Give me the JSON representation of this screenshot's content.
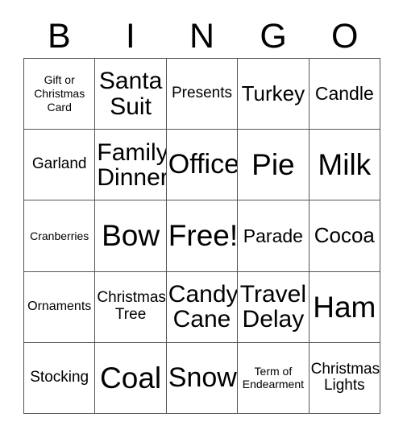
{
  "card": {
    "title_letters": [
      "B",
      "I",
      "N",
      "G",
      "O"
    ],
    "grid_columns": 5,
    "grid_rows": 5,
    "text_color": "#000000",
    "border_color": "#555555",
    "background_color": "#ffffff",
    "cells": [
      [
        {
          "label": "Gift or\nChristmas\nCard",
          "size": "fs-xs",
          "free": false
        },
        {
          "label": "Santa\nSuit",
          "size": "fs-xxl",
          "free": false
        },
        {
          "label": "Presents",
          "size": "fs-m",
          "free": false
        },
        {
          "label": "Turkey",
          "size": "fs-xl",
          "free": false
        },
        {
          "label": "Candle",
          "size": "fs-l",
          "free": false
        }
      ],
      [
        {
          "label": "Garland",
          "size": "fs-m",
          "free": false
        },
        {
          "label": "Family\nDinner",
          "size": "fs-xxl",
          "free": false
        },
        {
          "label": "Office",
          "size": "fs-3xl",
          "free": false
        },
        {
          "label": "Pie",
          "size": "fs-4xl",
          "free": false
        },
        {
          "label": "Milk",
          "size": "fs-4xl",
          "free": false
        }
      ],
      [
        {
          "label": "Cranberries",
          "size": "fs-xs",
          "free": false
        },
        {
          "label": "Bow",
          "size": "fs-4xl",
          "free": false
        },
        {
          "label": "Free!",
          "size": "fs-4xl",
          "free": true
        },
        {
          "label": "Parade",
          "size": "fs-l",
          "free": false
        },
        {
          "label": "Cocoa",
          "size": "fs-xl",
          "free": false
        }
      ],
      [
        {
          "label": "Ornaments",
          "size": "fs-s",
          "free": false
        },
        {
          "label": "Christmas\nTree",
          "size": "fs-m",
          "free": false
        },
        {
          "label": "Candy\nCane",
          "size": "fs-xxl",
          "free": false
        },
        {
          "label": "Travel\nDelay",
          "size": "fs-xxl",
          "free": false
        },
        {
          "label": "Ham",
          "size": "fs-4xl",
          "free": false
        }
      ],
      [
        {
          "label": "Stocking",
          "size": "fs-m",
          "free": false
        },
        {
          "label": "Coal",
          "size": "fs-4xl",
          "free": false
        },
        {
          "label": "Snow",
          "size": "fs-3xl",
          "free": false
        },
        {
          "label": "Term of\nEndearment",
          "size": "fs-xs",
          "free": false
        },
        {
          "label": "Christmas\nLights",
          "size": "fs-m",
          "free": false
        }
      ]
    ]
  }
}
